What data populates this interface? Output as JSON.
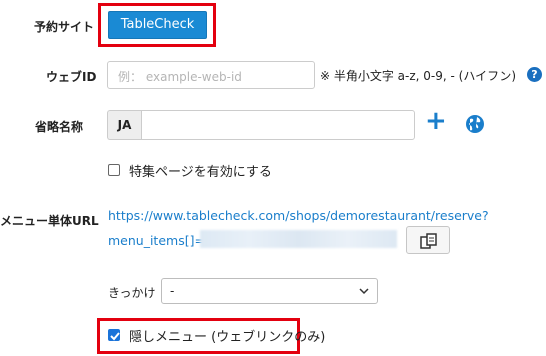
{
  "reservation_site": {
    "label": "予約サイト",
    "button": "TableCheck"
  },
  "web_id": {
    "label": "ウェブID",
    "placeholder": "例： example-web-id",
    "hint": "※ 半角小文字 a-z, 0-9, - (ハイフン)",
    "help_icon": "?"
  },
  "short_name": {
    "label": "省略名称",
    "lang": "JA",
    "add_icon": "+",
    "globe_icon": "globe-icon"
  },
  "feature_page": {
    "label": "特集ページを有効にする",
    "checked": false
  },
  "menu_url": {
    "label": "メニュー単体URL",
    "line1": "https://www.tablecheck.com/shops/demorestaurant/reserve?",
    "line2": "menu_items[]=",
    "copy_icon": "copy-icon"
  },
  "trigger": {
    "label": "きっかけ",
    "selected": "-"
  },
  "hidden_menu": {
    "label": "隠しメニュー (ウェブリンクのみ)",
    "checked": true
  },
  "colors": {
    "accent": "#1a8ad4",
    "highlight": "#e3000f",
    "link": "#1a7ecb"
  }
}
